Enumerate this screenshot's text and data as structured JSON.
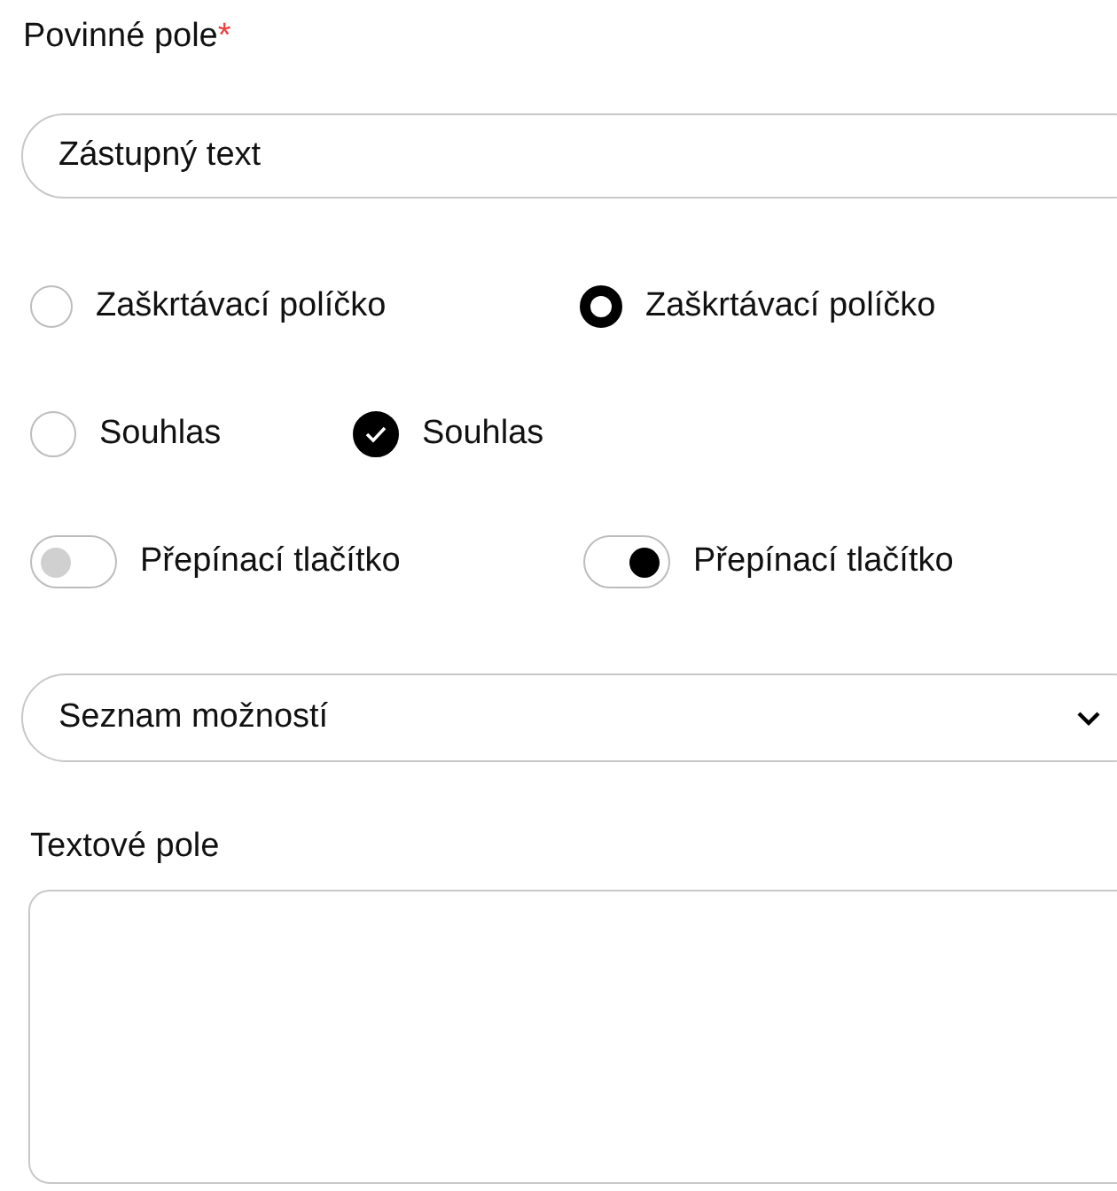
{
  "required_field": {
    "label": "Povinné pole",
    "required_mark": "*",
    "placeholder": "Zástupný text"
  },
  "radios": [
    {
      "label": "Zaškrtávací políčko",
      "selected": false
    },
    {
      "label": "Zaškrtávací políčko",
      "selected": true
    }
  ],
  "checkboxes": [
    {
      "label": "Souhlas",
      "checked": false
    },
    {
      "label": "Souhlas",
      "checked": true
    }
  ],
  "toggles": [
    {
      "label": "Přepínací tlačítko",
      "on": false
    },
    {
      "label": "Přepínací tlačítko",
      "on": true
    }
  ],
  "select": {
    "value": "Seznam možností"
  },
  "textarea": {
    "label": "Textové pole"
  }
}
